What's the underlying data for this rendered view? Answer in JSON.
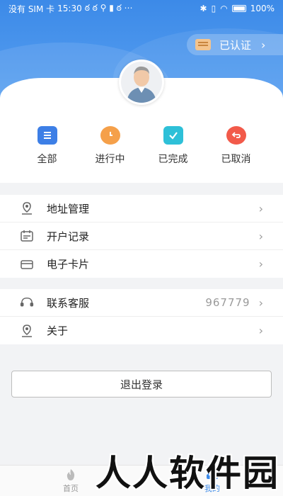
{
  "status_bar": {
    "carrier": "没有 SIM 卡",
    "time": "15:30",
    "battery": "100%"
  },
  "header": {
    "verify_label": "已认证"
  },
  "orders": [
    {
      "label": "全部",
      "icon": "clipboard-list-icon",
      "color": "#3d7fe6"
    },
    {
      "label": "进行中",
      "icon": "clock-icon",
      "color": "#f5a04a"
    },
    {
      "label": "已完成",
      "icon": "check-clipboard-icon",
      "color": "#2ec0d8"
    },
    {
      "label": "已取消",
      "icon": "undo-icon",
      "color": "#f25a4a"
    }
  ],
  "menu1": [
    {
      "label": "地址管理",
      "icon": "location-icon"
    },
    {
      "label": "开户记录",
      "icon": "calendar-icon"
    },
    {
      "label": "电子卡片",
      "icon": "card-icon"
    }
  ],
  "menu2": [
    {
      "label": "联系客服",
      "icon": "headset-icon",
      "value": "967779"
    },
    {
      "label": "关于",
      "icon": "location-info-icon"
    }
  ],
  "logout_label": "退出登录",
  "tabbar": {
    "home_label": "首页",
    "mine_label": "我的"
  },
  "watermark": "人人软件园"
}
